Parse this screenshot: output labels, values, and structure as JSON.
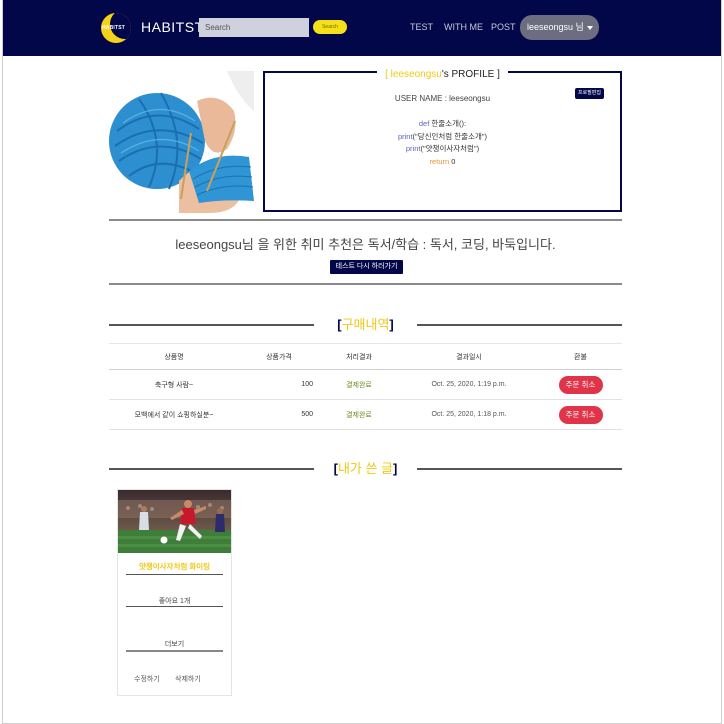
{
  "nav": {
    "brand_logo_text": "HABITST",
    "brand": "HABITST",
    "search_placeholder": "Search",
    "search_button": "Search",
    "links": [
      "TEST",
      "WITH ME",
      "POST"
    ],
    "user_menu": "leeseongsu 님"
  },
  "profile": {
    "title_user": "leeseongsu",
    "title_suffix": "'s PROFILE",
    "bracket_open": "[",
    "bracket_close": "]",
    "user_name_line": "USER NAME : leeseongsu",
    "edit_button": "프로필편집",
    "code": {
      "line1_kw": "def",
      "line1_rest": " 한줄소개():",
      "line2_kw": "print",
      "line2_rest": "(\"당신인처럼 한줄소개\")",
      "line3_kw": "print",
      "line3_rest": "(\"얏챙이사자처럼\")",
      "line4_kw": "return",
      "line4_rest": " 0"
    }
  },
  "recommend": {
    "text": "leeseongsu님 을 위한 취미 추천은 독서/학습 : 독서, 코딩, 바둑입니다.",
    "retest_button": "테스트 다시 하러가기"
  },
  "orders": {
    "section_title": "구매내역",
    "headers": [
      "상품명",
      "상품가격",
      "처리결과",
      "결과일시",
      "환불"
    ],
    "rows": [
      {
        "name": "축구형 사람~",
        "price": "100",
        "status": "결제완료",
        "date": "Oct. 25, 2020, 1:19 p.m.",
        "refund": "주문 취소"
      },
      {
        "name": "모백에서 같이 쇼핑하실분~",
        "price": "500",
        "status": "결제완료",
        "date": "Oct. 25, 2020, 1:18 p.m.",
        "refund": "주문 취소"
      }
    ]
  },
  "posts": {
    "section_title": "내가 쓴 글",
    "card": {
      "title": "얏챙이사자처럼 화이팅",
      "likes": "좋아요 1개",
      "more": "더보기",
      "edit": "수정하기",
      "delete": "삭제하기"
    }
  },
  "colors": {
    "navy": "#02074a",
    "yellow": "#f0c814",
    "red": "#e0344a",
    "green": "#6b8e23"
  }
}
